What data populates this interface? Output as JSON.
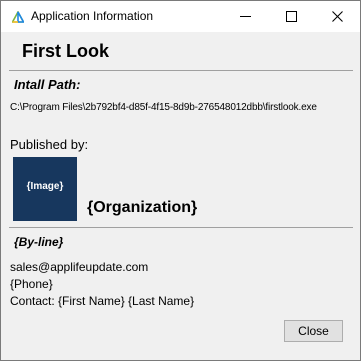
{
  "window": {
    "title": "Application Information",
    "icon": "app-triangle-icon",
    "controls": [
      "minimize-icon",
      "maximize-icon",
      "close-icon"
    ]
  },
  "app": {
    "name": "First Look"
  },
  "install": {
    "label": "Intall Path:",
    "path": "C:\\Program Files\\2b792bf4-d85f-4f15-8d9b-276548012dbb\\firstlook.exe"
  },
  "publisher": {
    "label": "Published by:",
    "logo_text": "{Image}",
    "organization": "{Organization}",
    "byline": "{By-line}"
  },
  "contact": {
    "email": "sales@applifeupdate.com",
    "phone": "{Phone}",
    "name": "Contact: {First Name} {Last Name}"
  },
  "buttons": {
    "close_label": "Close"
  },
  "colors": {
    "logo_bg": "#17375e",
    "dialog_bg": "#f0f0f0"
  }
}
